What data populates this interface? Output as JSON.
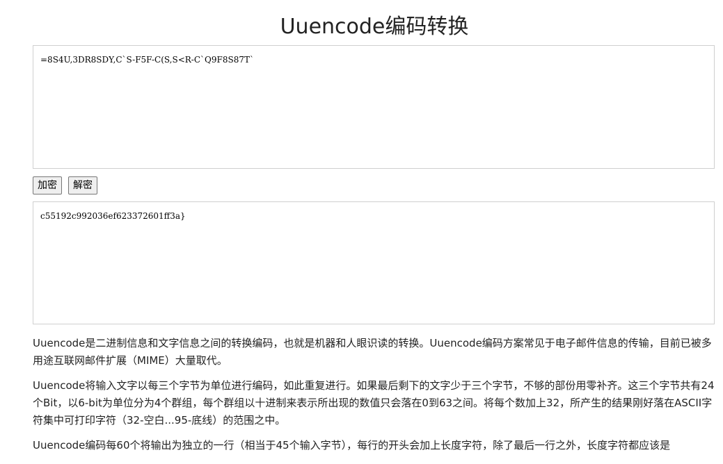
{
  "page": {
    "title": "Uuencode编码转换"
  },
  "input": {
    "value": "=8S4U,3DR8SDY,C`S-F5F-C(S,S<R-C`Q9F8S87T`"
  },
  "buttons": {
    "encrypt_label": "加密",
    "decrypt_label": "解密"
  },
  "output": {
    "value": "c55192c992036ef623372601ff3a}"
  },
  "description": {
    "paragraphs": [
      "Uuencode是二进制信息和文字信息之间的转换编码，也就是机器和人眼识读的转换。Uuencode编码方案常见于电子邮件信息的传输，目前已被多用途互联网邮件扩展（MIME）大量取代。",
      "Uuencode将输入文字以每三个字节为单位进行编码，如此重复进行。如果最后剩下的文字少于三个字节，不够的部份用零补齐。这三个字节共有24个Bit，以6-bit为单位分为4个群组，每个群组以十进制来表示所出现的数值只会落在0到63之间。将每个数加上32，所产生的结果刚好落在ASCII字符集中可打印字符（32-空白...95-底线）的范围之中。",
      "Uuencode编码每60个将输出为独立的一行（相当于45个输入字节），每行的开头会加上长度字符，除了最后一行之外，长度字符都应该是"
    ]
  }
}
